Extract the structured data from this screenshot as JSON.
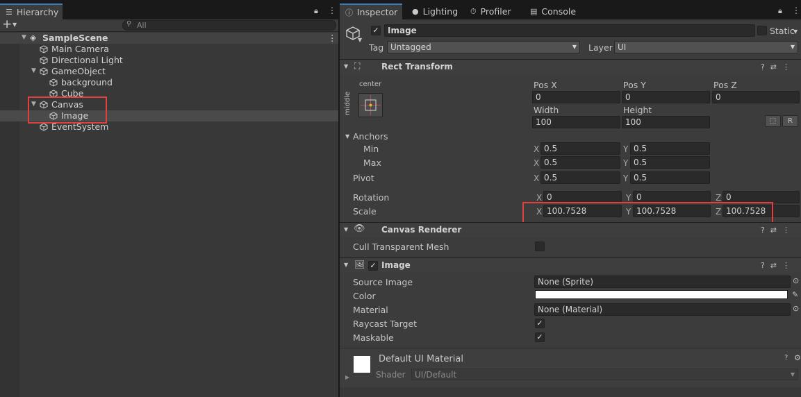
{
  "hierarchy": {
    "tab_label": "Hierarchy",
    "search_placeholder": "All",
    "scene_name": "SampleScene",
    "items": [
      {
        "label": "Main Camera"
      },
      {
        "label": "Directional Light"
      },
      {
        "label": "GameObject"
      },
      {
        "label": "background"
      },
      {
        "label": "Cube"
      },
      {
        "label": "Canvas"
      },
      {
        "label": "Image"
      },
      {
        "label": "EventSystem"
      }
    ]
  },
  "tabs": [
    "Inspector",
    "Lighting",
    "Profiler",
    "Console"
  ],
  "object": {
    "name": "Image",
    "static_label": "Static",
    "tag_label": "Tag",
    "tag_value": "Untagged",
    "layer_label": "Layer",
    "layer_value": "UI"
  },
  "rect_transform": {
    "title": "Rect Transform",
    "anchor_h": "center",
    "anchor_v": "middle",
    "posx_label": "Pos X",
    "posx": "0",
    "posy_label": "Pos Y",
    "posy": "0",
    "posz_label": "Pos Z",
    "posz": "0",
    "width_label": "Width",
    "width": "100",
    "height_label": "Height",
    "height": "100",
    "r_button": "R",
    "anchors_label": "Anchors",
    "min_label": "Min",
    "min_x": "0.5",
    "min_y": "0.5",
    "max_label": "Max",
    "max_x": "0.5",
    "max_y": "0.5",
    "pivot_label": "Pivot",
    "pivot_x": "0.5",
    "pivot_y": "0.5",
    "rotation_label": "Rotation",
    "rot_x": "0",
    "rot_y": "0",
    "rot_z": "0",
    "scale_label": "Scale",
    "scale_x": "100.7528",
    "scale_y": "100.7528",
    "scale_z": "100.7528",
    "x": "X",
    "y": "Y",
    "z": "Z"
  },
  "canvas_renderer": {
    "title": "Canvas Renderer",
    "cull_label": "Cull Transparent Mesh",
    "cull_checked": false
  },
  "image_component": {
    "title": "Image",
    "source_label": "Source Image",
    "source_value": "None (Sprite)",
    "color_label": "Color",
    "color_value": "#ffffff",
    "material_label": "Material",
    "material_value": "None (Material)",
    "raycast_label": "Raycast Target",
    "raycast_checked": true,
    "maskable_label": "Maskable",
    "maskable_checked": true
  },
  "material": {
    "name": "Default UI Material",
    "shader_label": "Shader",
    "shader_value": "UI/Default"
  },
  "colors": {
    "accent": "#3a79bb",
    "highlight": "#e0403e",
    "selected_row": "#4a4a4a"
  }
}
